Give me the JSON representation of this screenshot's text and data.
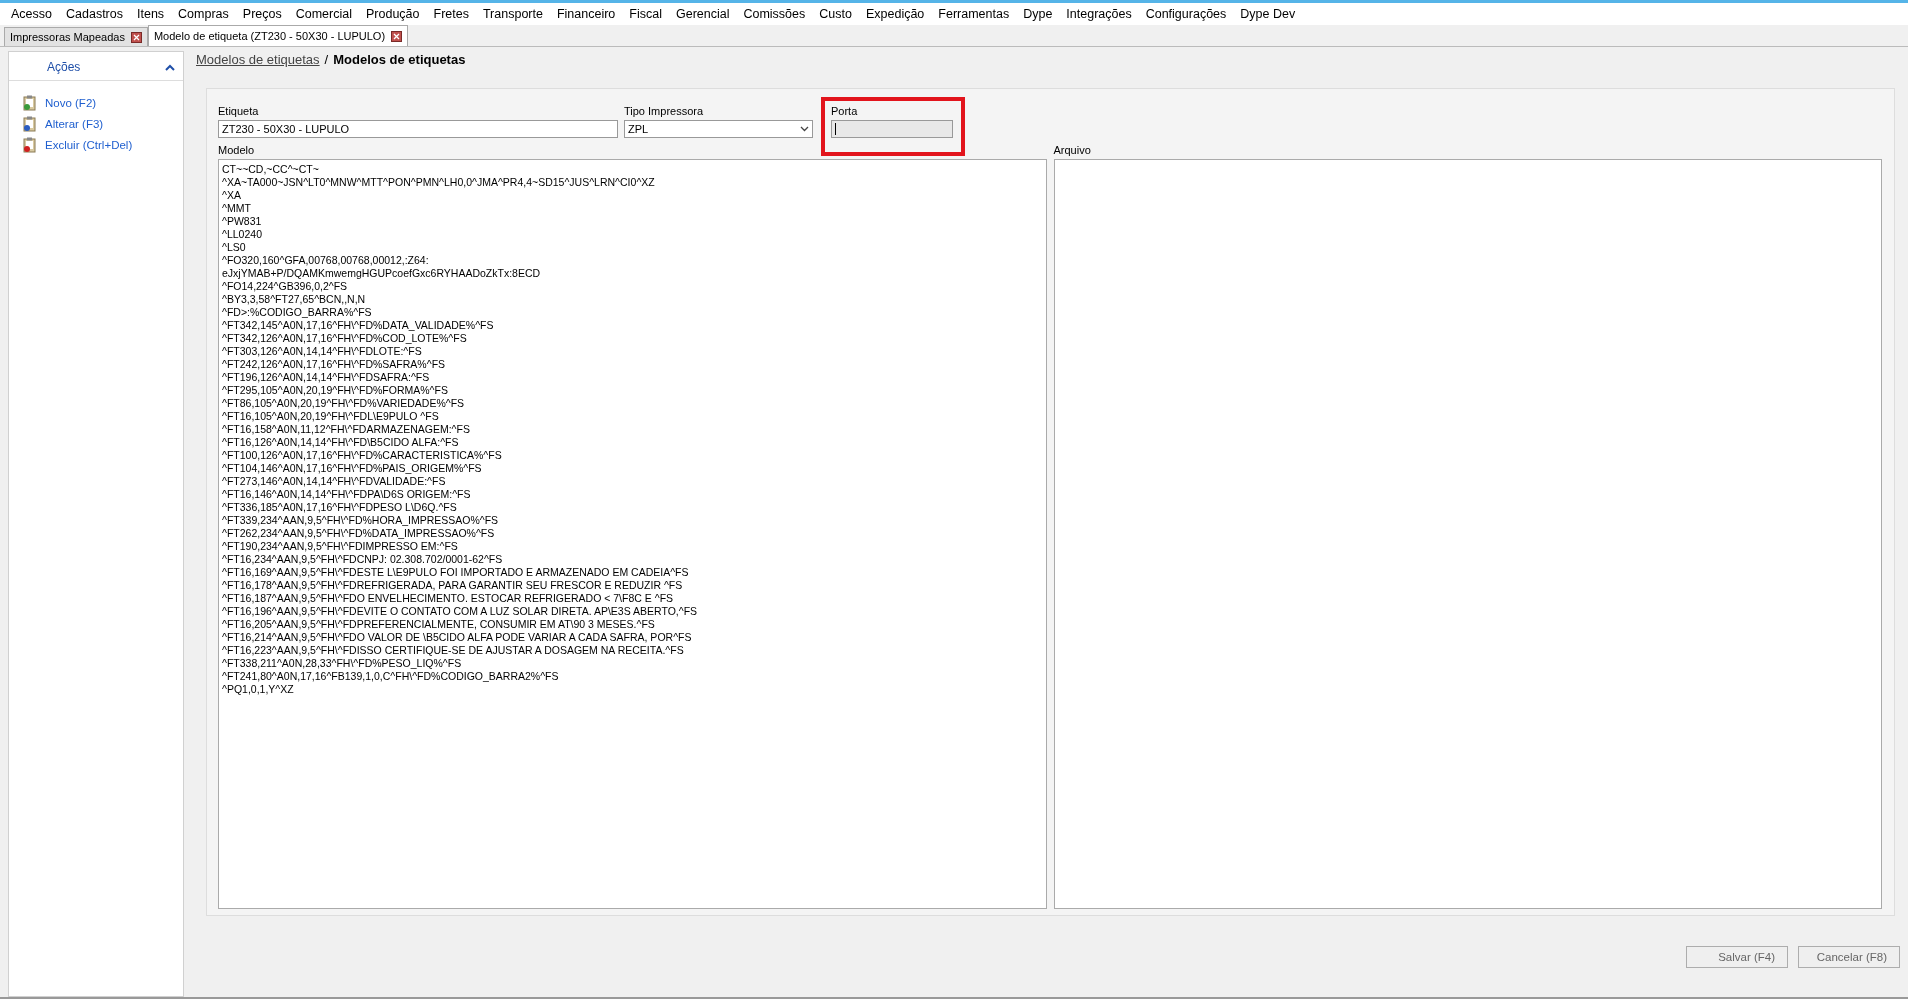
{
  "menu": [
    "Acesso",
    "Cadastros",
    "Itens",
    "Compras",
    "Preços",
    "Comercial",
    "Produção",
    "Fretes",
    "Transporte",
    "Financeiro",
    "Fiscal",
    "Gerencial",
    "Comissões",
    "Custo",
    "Expedição",
    "Ferramentas",
    "Dype",
    "Integrações",
    "Configurações",
    "Dype Dev"
  ],
  "tabs": [
    {
      "label": "Impressoras Mapeadas",
      "selected": false
    },
    {
      "label": "Modelo de etiqueta (ZT230 - 50X30 - LUPULO)",
      "selected": true
    }
  ],
  "sidebar": {
    "title": "Ações",
    "expanded": true,
    "items": [
      {
        "label": "Novo (F2)",
        "kind": "new"
      },
      {
        "label": "Alterar (F3)",
        "kind": "edit"
      },
      {
        "label": "Excluir (Ctrl+Del)",
        "kind": "delete"
      }
    ]
  },
  "breadcrumb": {
    "link": "Modelos de etiquetas ",
    "separator": "/",
    "current": "Modelos de etiquetas"
  },
  "form": {
    "etiqueta": {
      "label": "Etiqueta",
      "value": "ZT230 - 50X30 -  LUPULO"
    },
    "tipo_impressora": {
      "label": "Tipo Impressora",
      "value": "ZPL"
    },
    "porta": {
      "label": "Porta",
      "disabled": true,
      "highlighted": true
    },
    "modelo": {
      "label": "Modelo",
      "lines": [
        "CT~~CD,~CC^~CT~",
        "^XA~TA000~JSN^LT0^MNW^MTT^PON^PMN^LH0,0^JMA^PR4,4~SD15^JUS^LRN^CI0^XZ",
        "^XA",
        "^MMT",
        "^PW831",
        "^LL0240",
        "^LS0",
        "^FO320,160^GFA,00768,00768,00012,:Z64:",
        "eJxjYMAB+P/DQAMKmwemgHGUPcoefGxc6RYHAADoZkTx:8ECD",
        "^FO14,224^GB396,0,2^FS",
        "^BY3,3,58^FT27,65^BCN,,N,N",
        "^FD>:%CODIGO_BARRA%^FS",
        "^FT342,145^A0N,17,16^FH\\^FD%DATA_VALIDADE%^FS",
        "^FT342,126^A0N,17,16^FH\\^FD%COD_LOTE%^FS",
        "^FT303,126^A0N,14,14^FH\\^FDLOTE:^FS",
        "^FT242,126^A0N,17,16^FH\\^FD%SAFRA%^FS",
        "^FT196,126^A0N,14,14^FH\\^FDSAFRA:^FS",
        "^FT295,105^A0N,20,19^FH\\^FD%FORMA%^FS",
        "^FT86,105^A0N,20,19^FH\\^FD%VARIEDADE%^FS",
        "^FT16,105^A0N,20,19^FH\\^FDL\\E9PULO ^FS",
        "^FT16,158^A0N,11,12^FH\\^FDARMAZENAGEM:^FS",
        "^FT16,126^A0N,14,14^FH\\^FD\\B5CIDO ALFA:^FS",
        "^FT100,126^A0N,17,16^FH\\^FD%CARACTERISTICA%^FS",
        "^FT104,146^A0N,17,16^FH\\^FD%PAIS_ORIGEM%^FS",
        "^FT273,146^A0N,14,14^FH\\^FDVALIDADE:^FS",
        "^FT16,146^A0N,14,14^FH\\^FDPA\\D6S ORIGEM:^FS",
        "^FT336,185^A0N,17,16^FH\\^FDPESO L\\D6Q.^FS",
        "^FT339,234^AAN,9,5^FH\\^FD%HORA_IMPRESSAO%^FS",
        "^FT262,234^AAN,9,5^FH\\^FD%DATA_IMPRESSAO%^FS",
        "^FT190,234^AAN,9,5^FH\\^FDIMPRESSO EM:^FS",
        "^FT16,234^AAN,9,5^FH\\^FDCNPJ: 02.308.702/0001-62^FS",
        "^FT16,169^AAN,9,5^FH\\^FDESTE L\\E9PULO FOI IMPORTADO E ARMAZENADO EM CADEIA^FS",
        "^FT16,178^AAN,9,5^FH\\^FDREFRIGERADA, PARA GARANTIR SEU FRESCOR E REDUZIR ^FS",
        "^FT16,187^AAN,9,5^FH\\^FDO ENVELHECIMENTO. ESTOCAR REFRIGERADO < 7\\F8C E ^FS",
        "^FT16,196^AAN,9,5^FH\\^FDEVITE O CONTATO COM A LUZ SOLAR DIRETA. AP\\E3S ABERTO,^FS",
        "^FT16,205^AAN,9,5^FH\\^FDPREFERENCIALMENTE, CONSUMIR EM AT\\90 3 MESES.^FS",
        "^FT16,214^AAN,9,5^FH\\^FDO VALOR DE \\B5CIDO ALFA PODE VARIAR A CADA SAFRA, POR^FS",
        "^FT16,223^AAN,9,5^FH\\^FDISSO CERTIFIQUE-SE DE AJUSTAR A DOSAGEM NA RECEITA.^FS",
        "^FT338,211^A0N,28,33^FH\\^FD%PESO_LIQ%^FS",
        "^FT241,80^A0N,17,16^FB139,1,0,C^FH\\^FD%CODIGO_BARRA2%^FS",
        "^PQ1,0,1,Y^XZ"
      ]
    },
    "arquivo": {
      "label": "Arquivo"
    }
  },
  "buttons": [
    "Salvar (F4)",
    "Cancelar (F8)"
  ]
}
